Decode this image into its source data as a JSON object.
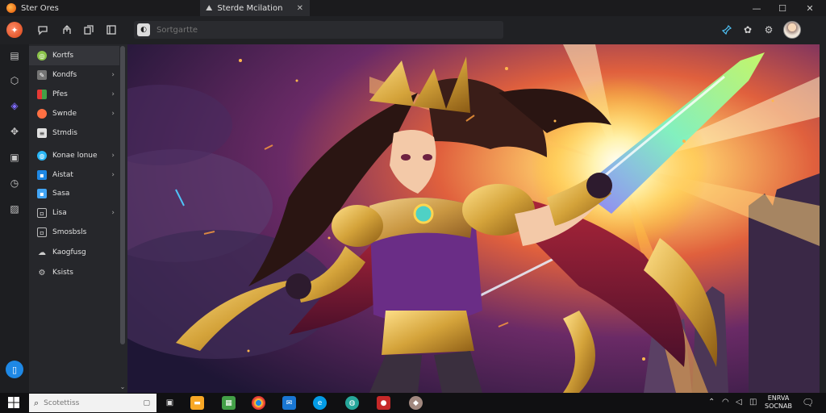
{
  "window": {
    "app_title": "Ster Ores",
    "tab_label": "Sterde Mcilation",
    "minimize": "—",
    "maximize": "☐",
    "close": "✕"
  },
  "toolbar": {
    "address_placeholder": "Sortgartte"
  },
  "sidebar": {
    "items": [
      {
        "label": "Kortfs",
        "icon": "globe-icon",
        "color": "#8bc34a",
        "chevron": false
      },
      {
        "label": "Kondfs",
        "icon": "edit-icon",
        "color": "#9e9e9e",
        "chevron": true
      },
      {
        "label": "Pfes",
        "icon": "files-icon",
        "color": "#e53935",
        "chevron": true
      },
      {
        "label": "Swnde",
        "icon": "circle-icon",
        "color": "#ff7043",
        "chevron": true
      },
      {
        "label": "Stmdis",
        "icon": "doc-icon",
        "color": "#e0e0e0",
        "chevron": false
      },
      {
        "label": "Konae lonue",
        "icon": "globe-icon",
        "color": "#29b6f6",
        "chevron": true
      },
      {
        "label": "Aistat",
        "icon": "window-icon",
        "color": "#1e88e5",
        "chevron": true
      },
      {
        "label": "Sasa",
        "icon": "window-icon",
        "color": "#42a5f5",
        "chevron": false
      },
      {
        "label": "Lisa",
        "icon": "image-icon",
        "color": "#9e9e9e",
        "chevron": true
      },
      {
        "label": "Smosbsls",
        "icon": "image-icon",
        "color": "#9e9e9e",
        "chevron": false
      },
      {
        "label": "Kaogfusg",
        "icon": "cloud-icon",
        "color": "#9e9e9e",
        "chevron": false
      },
      {
        "label": "Ksists",
        "icon": "gear-icon",
        "color": "#9e9e9e",
        "chevron": false
      }
    ]
  },
  "taskbar": {
    "search_placeholder": "Scotettiss",
    "clock_line1": "ENRVA",
    "clock_line2": "SOCNAB"
  },
  "colors": {
    "accent": "#1e88e5",
    "chrome": "#202124",
    "sidebar": "#26272b"
  }
}
